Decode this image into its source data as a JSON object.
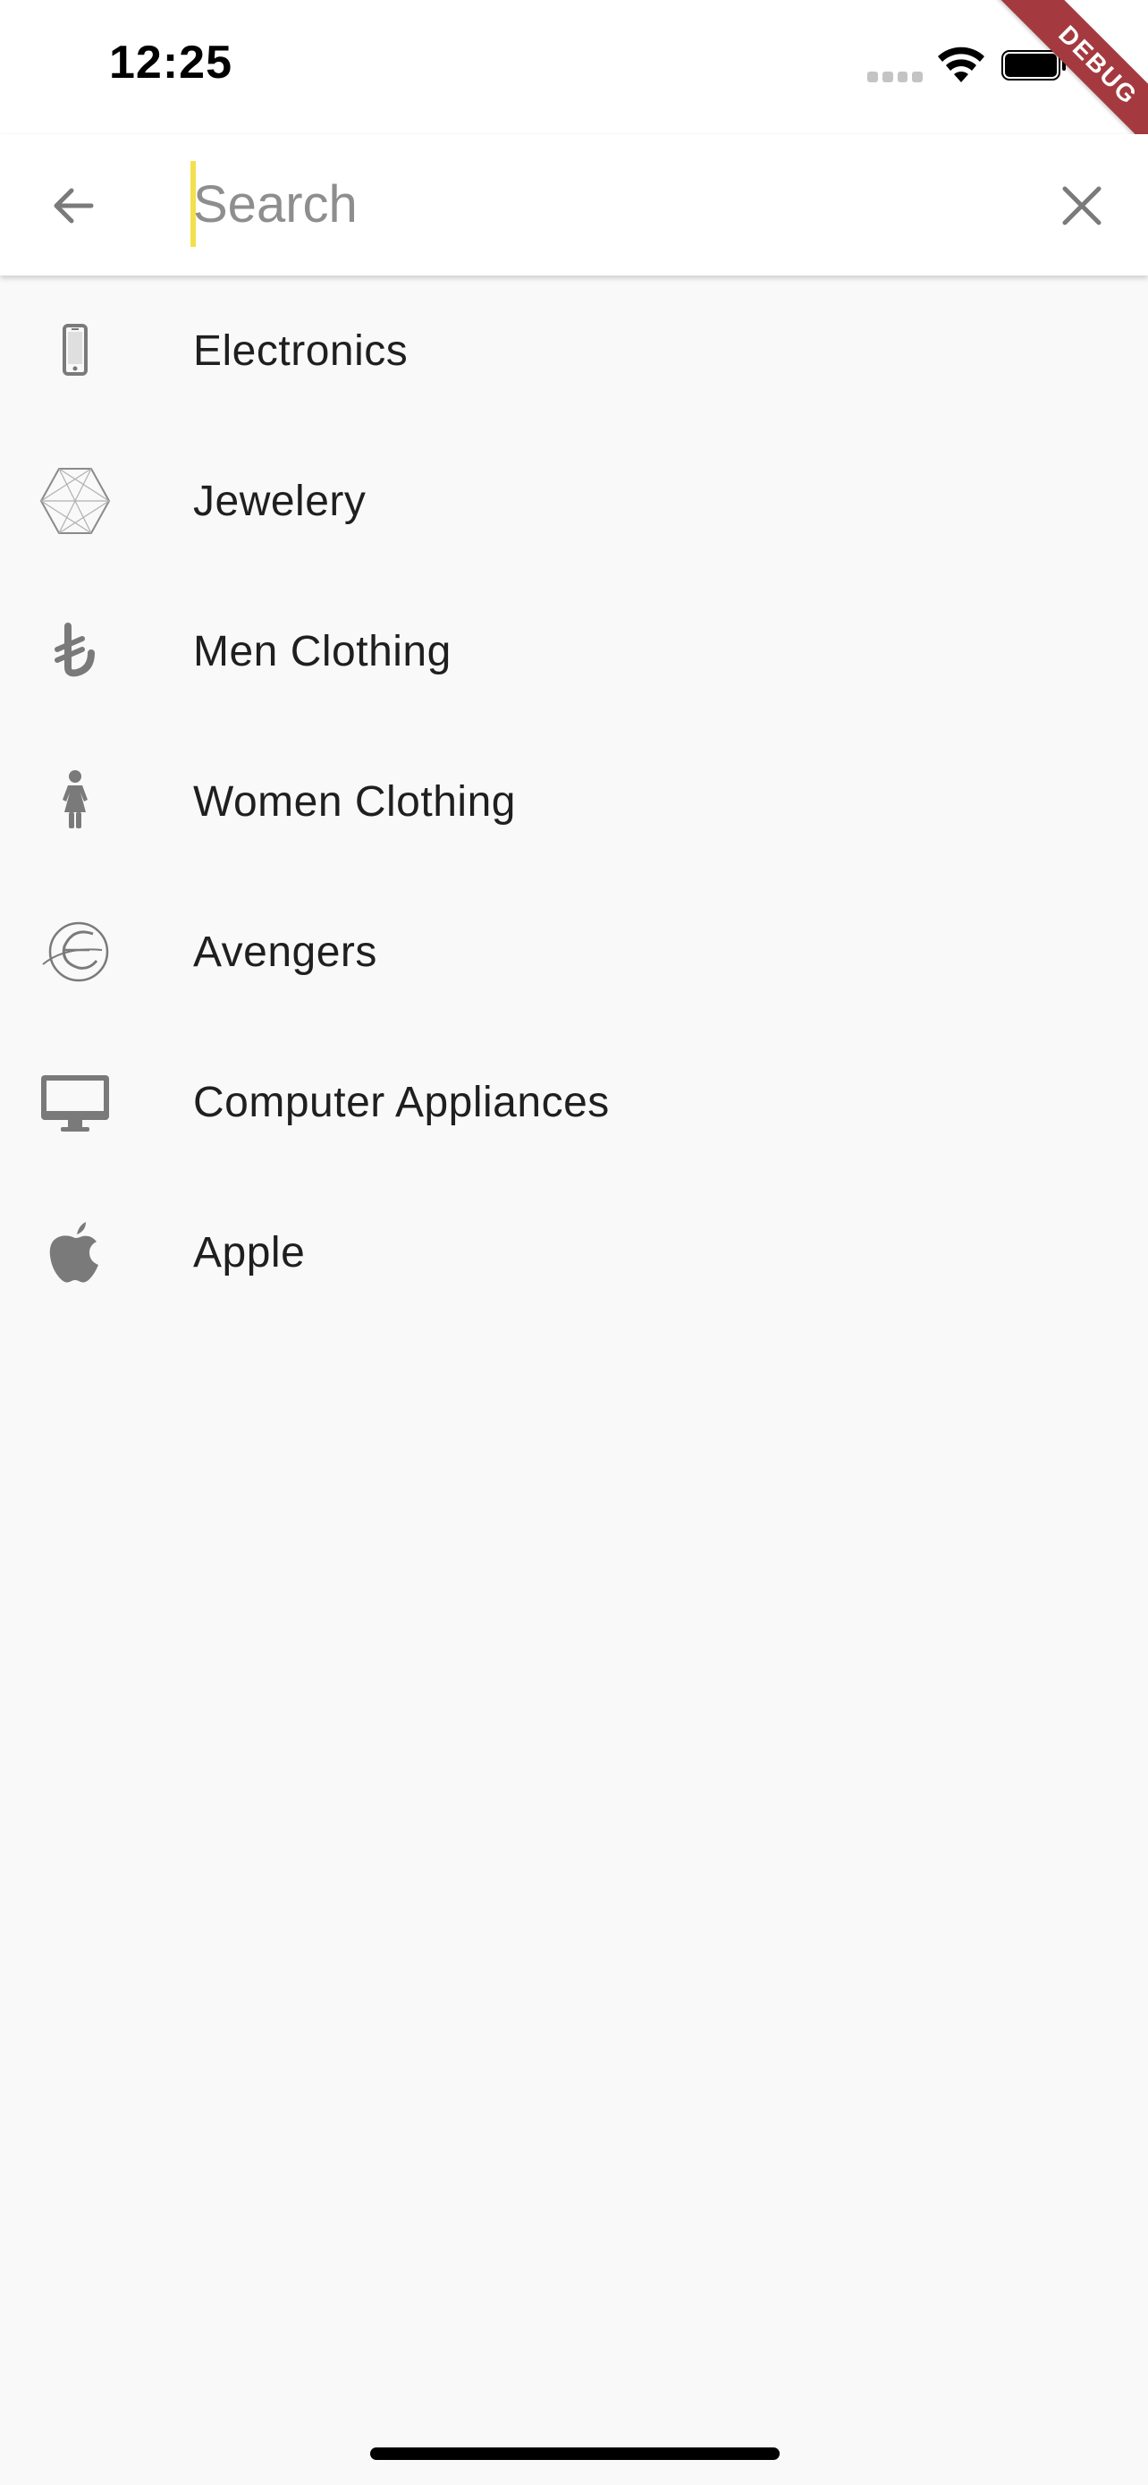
{
  "status_bar": {
    "time": "12:25"
  },
  "debug_banner": {
    "label": "DEBUG",
    "color": "#a43a3f"
  },
  "search": {
    "placeholder": "Search",
    "value": "",
    "caret_color": "#f4e04d",
    "back_icon": "arrow-left-icon",
    "clear_icon": "close-icon"
  },
  "categories": [
    {
      "label": "Electronics",
      "icon": "smartphone-icon"
    },
    {
      "label": "Jewelery",
      "icon": "hexagon-gem-icon"
    },
    {
      "label": "Men Clothing",
      "icon": "lira-icon"
    },
    {
      "label": "Women Clothing",
      "icon": "woman-icon"
    },
    {
      "label": "Avengers",
      "icon": "globe-swoosh-icon"
    },
    {
      "label": "Computer Appliances",
      "icon": "desktop-monitor-icon"
    },
    {
      "label": "Apple",
      "icon": "apple-icon"
    }
  ],
  "colors": {
    "background": "#f9f9f9",
    "app_bar": "#ffffff",
    "icon_grey": "#7a7a7a",
    "text": "#1f1f1f"
  }
}
